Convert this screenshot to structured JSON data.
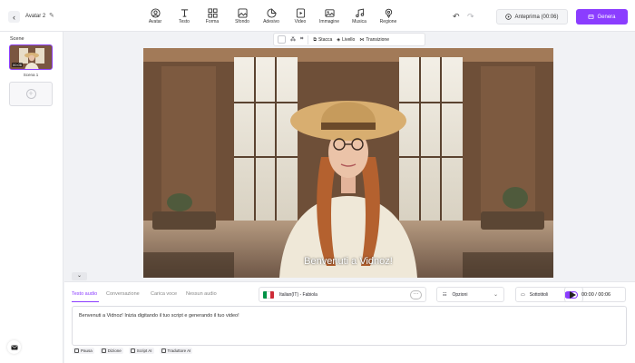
{
  "header": {
    "project_name": "Avatar 2",
    "tools": [
      {
        "label": "Avatar",
        "icon": "avatar-icon"
      },
      {
        "label": "Testo",
        "icon": "text-icon"
      },
      {
        "label": "Forma",
        "icon": "shapes-icon"
      },
      {
        "label": "Sfondo",
        "icon": "background-icon"
      },
      {
        "label": "Adesivo",
        "icon": "sticker-icon"
      },
      {
        "label": "Video",
        "icon": "video-icon"
      },
      {
        "label": "Immagine",
        "icon": "image-icon"
      },
      {
        "label": "Musica",
        "icon": "music-icon"
      },
      {
        "label": "Regione",
        "icon": "region-icon"
      }
    ],
    "preview_label": "Anteprima (00:06)",
    "generate_label": "Genera"
  },
  "scenes": {
    "title": "Scene",
    "items": [
      {
        "label": "Scena 1",
        "duration": "00:06"
      }
    ]
  },
  "canvas_toolbar": {
    "items": [
      {
        "label": "Stacca",
        "icon": "detach-icon"
      },
      {
        "label": "Livello",
        "icon": "layers-icon"
      },
      {
        "label": "Transizione",
        "icon": "transition-icon"
      }
    ]
  },
  "canvas": {
    "caption": "Benvenuti a Vidnoz!"
  },
  "bottom": {
    "tabs": [
      "Testo audio",
      "Conversazione",
      "Carica voce",
      "Nessun audio"
    ],
    "active_tab": 0,
    "voice": {
      "name": "Italian(IT) - Fabiola",
      "more": "···"
    },
    "options_label": "Opzioni",
    "subtitles_label": "Sottotitoli",
    "subtitles_on": true,
    "time": "00:00 / 00:06",
    "script_text": "Benvenuti a Vidnoz! Inizia digitando il tuo script e generando il tuo video!",
    "chips": [
      {
        "label": "Pausa"
      },
      {
        "label": "Dizione"
      },
      {
        "label": "Script AI"
      },
      {
        "label": "Traduttore AI"
      }
    ]
  },
  "colors": {
    "accent": "#8b3dff",
    "flag": [
      "#009246",
      "#ffffff",
      "#ce2b37"
    ]
  }
}
